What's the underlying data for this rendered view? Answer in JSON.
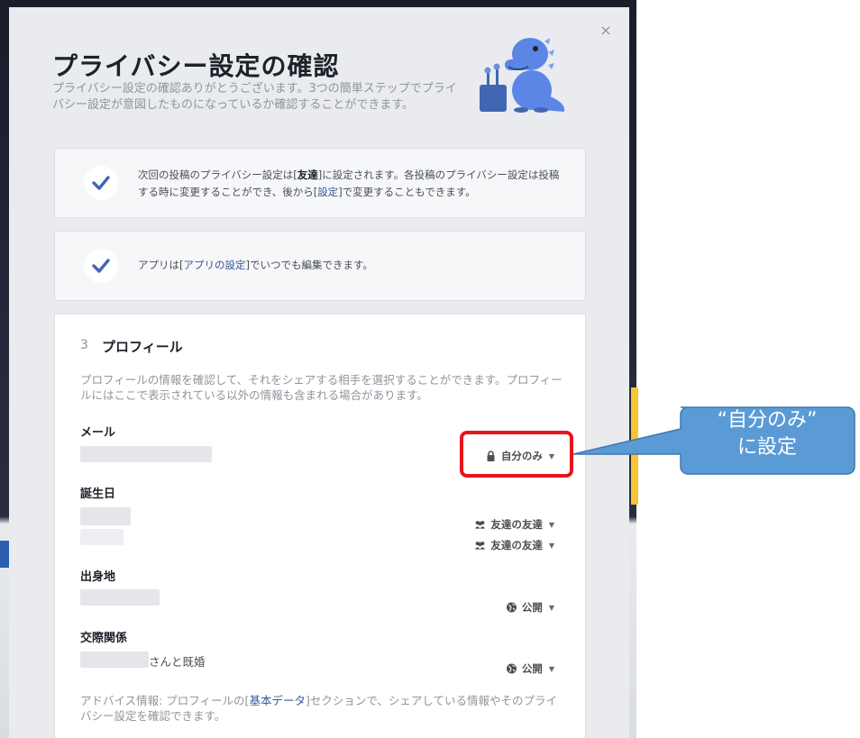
{
  "dialog": {
    "title": "プライバシー設定の確認",
    "subtitle": "プライバシー設定の確認ありがとうございます。3つの簡単ステップでプライバシー設定が意図したものになっているか確認することができます。",
    "close_label": "×"
  },
  "cards": [
    {
      "text_before": "次回の投稿のプライバシー設定は[",
      "bold": "友達",
      "text_mid": "]に設定されます。各投稿のプライバシー設定は投稿する時に変更することができ、後から[",
      "link": "設定",
      "text_after": "]で変更することもできます。"
    },
    {
      "text_before": "アプリは[",
      "link": "アプリの設定",
      "text_after": "]でいつでも編集できます。"
    }
  ],
  "profile": {
    "step_number": "3",
    "step_title": "プロフィール",
    "description": "プロフィールの情報を確認して、それをシェアする相手を選択することができます。プロフィールにはここで表示されている以外の情報も含まれる場合があります。",
    "fields": [
      {
        "label": "メール",
        "audience": "自分のみ",
        "audience_icon": "lock-icon"
      },
      {
        "label": "誕生日",
        "audience": "友達の友達",
        "audience2": "友達の友達",
        "audience_icon": "friends-icon"
      },
      {
        "label": "出身地",
        "audience": "公開",
        "audience_icon": "globe-icon"
      },
      {
        "label": "交際関係",
        "value_suffix": "さんと既婚",
        "audience": "公開",
        "audience_icon": "globe-icon"
      }
    ],
    "advice_before": "アドバイス情報: プロフィールの[",
    "advice_link": "基本データ",
    "advice_after": "]セクションで、シェアしている情報やそのプライバシー設定を確認できます。"
  },
  "annotation": {
    "line1": "“自分のみ”",
    "line2": "に設定",
    "box_color": "#e8141b",
    "callout_color": "#5b9bd5"
  },
  "colors": {
    "link": "#365899",
    "muted": "#90949c",
    "check": "#4267b2"
  }
}
